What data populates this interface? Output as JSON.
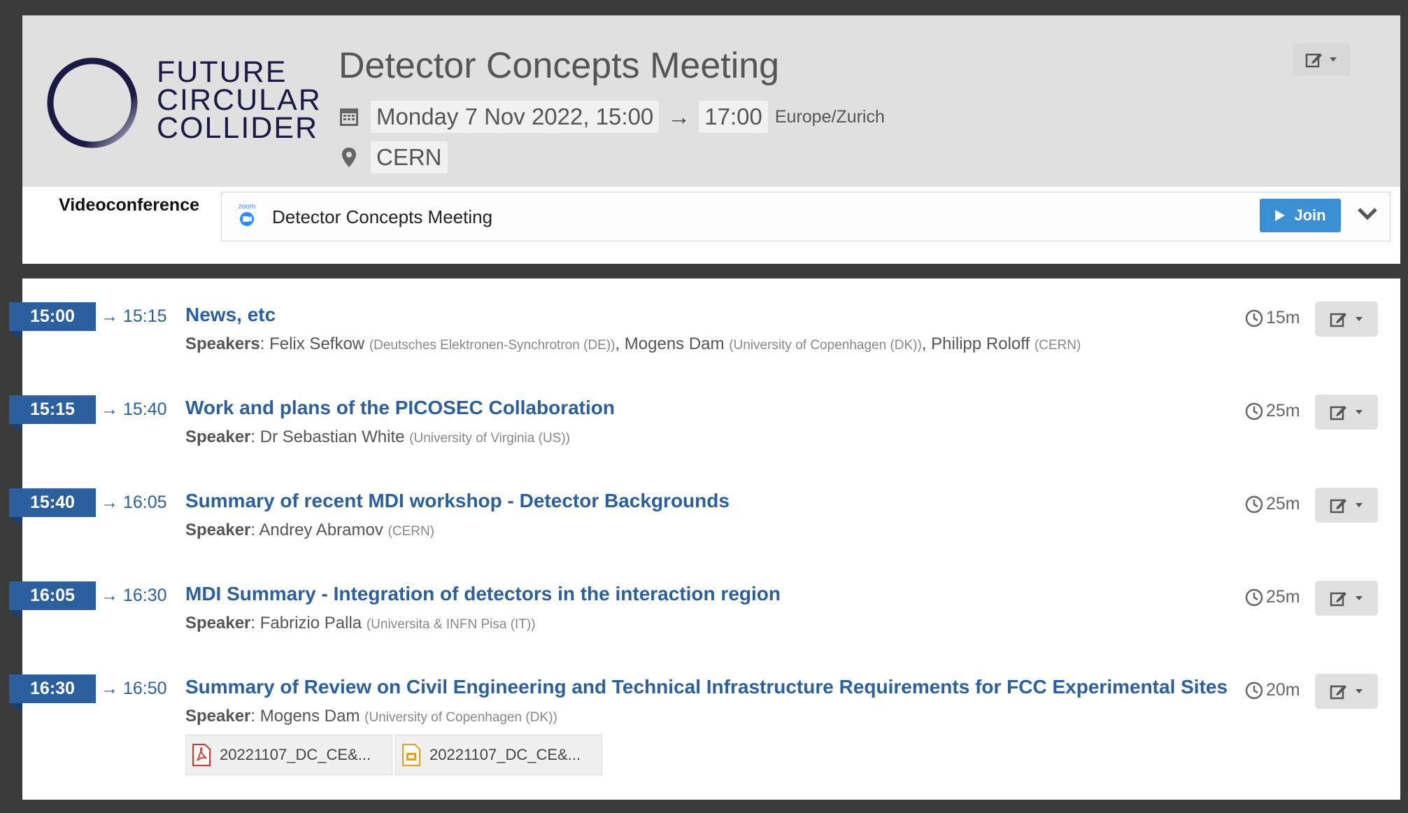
{
  "logo": {
    "line1": "FUTURE",
    "line2": "CIRCULAR",
    "line3": "COLLIDER"
  },
  "event": {
    "title": "Detector Concepts Meeting",
    "date_start": "Monday 7 Nov 2022, 15:00",
    "arrow": "→",
    "time_end": "17:00",
    "timezone": "Europe/Zurich",
    "location": "CERN"
  },
  "videoconference": {
    "label": "Videoconference",
    "room_name": "Detector Concepts Meeting",
    "join_label": "Join",
    "provider_icon": "zoom-icon"
  },
  "contributions": [
    {
      "start": "15:00",
      "end": "→ 15:15",
      "title": "News, etc",
      "duration": "15m",
      "speaker_label": "Speakers",
      "speakers": [
        {
          "name": "Felix Sefkow",
          "affiliation": "(Deutsches Elektronen-Synchrotron (DE))"
        },
        {
          "name": "Mogens Dam",
          "affiliation": "(University of Copenhagen (DK))"
        },
        {
          "name": "Philipp Roloff",
          "affiliation": "(CERN)"
        }
      ]
    },
    {
      "start": "15:15",
      "end": "→ 15:40",
      "title": "Work and plans of the PICOSEC Collaboration",
      "duration": "25m",
      "speaker_label": "Speaker",
      "speakers": [
        {
          "name": "Dr Sebastian White",
          "affiliation": "(University of Virginia (US))"
        }
      ]
    },
    {
      "start": "15:40",
      "end": "→ 16:05",
      "title": "Summary of recent MDI workshop - Detector Backgrounds",
      "duration": "25m",
      "speaker_label": "Speaker",
      "speakers": [
        {
          "name": "Andrey Abramov",
          "affiliation": "(CERN)"
        }
      ]
    },
    {
      "start": "16:05",
      "end": "→ 16:30",
      "title": "MDI Summary - Integration of detectors in the interaction region",
      "duration": "25m",
      "speaker_label": "Speaker",
      "speakers": [
        {
          "name": "Fabrizio Palla",
          "affiliation": "(Universita & INFN Pisa (IT))"
        }
      ]
    },
    {
      "start": "16:30",
      "end": "→ 16:50",
      "title": "Summary of Review on Civil Engineering and Technical Infrastructure Requirements for FCC Experimental Sites",
      "duration": "20m",
      "speaker_label": "Speaker",
      "speakers": [
        {
          "name": "Mogens Dam",
          "affiliation": "(University of Copenhagen (DK))"
        }
      ],
      "files": [
        {
          "name": "20221107_DC_CE&...",
          "icon": "pdf-icon",
          "color": "#d9342b"
        },
        {
          "name": "20221107_DC_CE&...",
          "icon": "presentation-file-icon",
          "color": "#e0a020"
        }
      ]
    }
  ],
  "colors": {
    "accent": "#2b5f9e",
    "join": "#3b8fd3",
    "logo": "#1b1a44"
  }
}
